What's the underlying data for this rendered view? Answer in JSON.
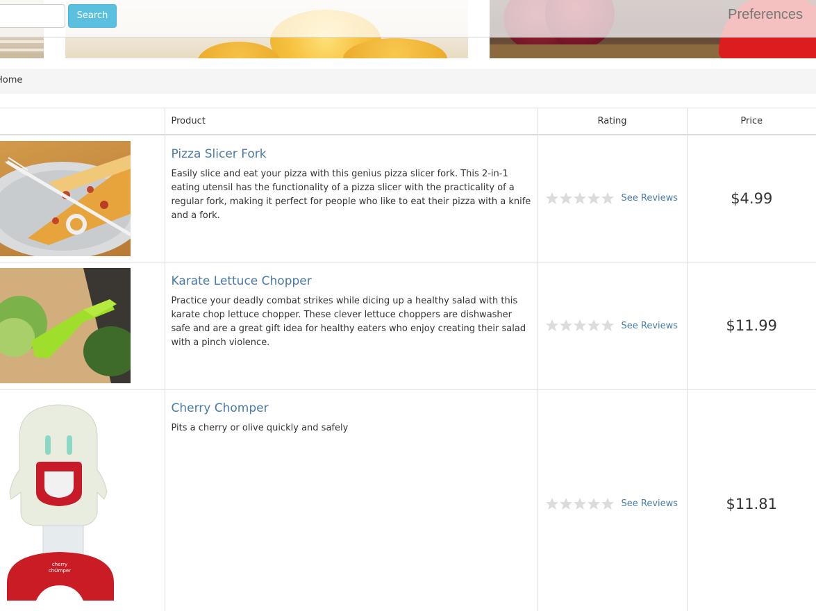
{
  "header": {
    "search": {
      "placeholder": "",
      "button_label": "Search"
    },
    "preferences_label": "Preferences"
  },
  "breadcrumb": {
    "home_label": "Home"
  },
  "table": {
    "columns": {
      "product": "Product",
      "rating": "Rating",
      "price": "Price"
    },
    "rows": [
      {
        "name": "Pizza Slicer Fork",
        "description": "Easily slice and eat your pizza with this genius pizza slicer fork. This 2-in-1 eating utensil has the functionality of a pizza slicer with the practicality of a regular fork, making it perfect for people who like to eat their pizza with a knife and a fork.",
        "rating_stars": 0,
        "reviews_label": "See Reviews",
        "price": "$4.99"
      },
      {
        "name": "Karate Lettuce Chopper",
        "description": "Practice your deadly combat strikes while dicing up a healthy salad with this karate chop lettuce chopper. These clever lettuce choppers are dishwasher safe and are a great gift idea for healthy eaters who enjoy creating their salad with a pinch violence.",
        "rating_stars": 0,
        "reviews_label": "See Reviews",
        "price": "$11.99"
      },
      {
        "name": "Cherry Chomper",
        "description": "Pits a cherry or olive quickly and safely",
        "rating_stars": 0,
        "reviews_label": "See Reviews",
        "price": "$11.81"
      }
    ]
  },
  "colors": {
    "link": "#4a7aa7",
    "search_button": "#5bc0de",
    "star_empty": "#dcdcdc",
    "breadcrumb_bg": "#f5f5f5"
  },
  "icons": {
    "rating_star": "star-icon"
  }
}
